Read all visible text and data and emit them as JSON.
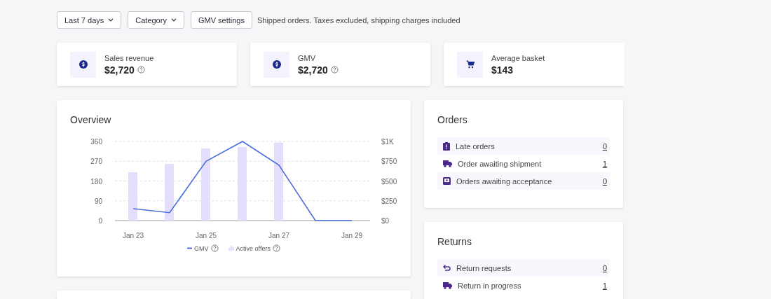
{
  "filters": [
    {
      "label": "Last 7 days",
      "kind": "dropdown"
    },
    {
      "label": "Category",
      "kind": "dropdown"
    },
    {
      "label": "GMV settings",
      "kind": "button"
    }
  ],
  "filter_note": "Shipped orders. Taxes excluded, shipping charges included",
  "kpis": [
    {
      "label": "Sales revenue",
      "value": "$2,720",
      "kind": "money",
      "help": true
    },
    {
      "label": "GMV",
      "value": "$2,720",
      "kind": "money",
      "help": true
    },
    {
      "label": "Average basket",
      "value": "$143",
      "kind": "cart",
      "help": false
    }
  ],
  "overview": {
    "title": "Overview",
    "chart_data": {
      "type": "bar",
      "grid": true,
      "legend": "bottom",
      "categories": [
        "Jan 23",
        null,
        "Jan 25",
        null,
        "Jan 27",
        null,
        "Jan 29"
      ],
      "ylim": [
        0,
        360
      ],
      "yticks": [
        0,
        90,
        180,
        270,
        360
      ],
      "y2lim": [
        0,
        1000
      ],
      "y2ticks": [
        {
          "value": 0,
          "label": "$0"
        },
        {
          "value": 250,
          "label": "$250"
        },
        {
          "value": 500,
          "label": "$500"
        },
        {
          "value": 750,
          "label": "$750"
        },
        {
          "value": 1000,
          "label": "$1K"
        }
      ],
      "series": [
        {
          "name": "GMV",
          "color": "#4a6fdc",
          "type": "line",
          "axis": "y2",
          "values": [
            150,
            100,
            750,
            1000,
            700,
            0,
            0
          ]
        },
        {
          "name": "Active offers",
          "color": "#e3defc",
          "type": "bar",
          "values": [
            220,
            258,
            328,
            335,
            355,
            0,
            0
          ]
        }
      ]
    }
  },
  "orders": {
    "title": "Orders",
    "items": [
      {
        "label": "Late orders",
        "count": "0"
      },
      {
        "label": "Order awaiting shipment",
        "count": "1"
      },
      {
        "label": "Orders awaiting acceptance",
        "count": "0"
      }
    ]
  },
  "returns": {
    "title": "Returns",
    "items": [
      {
        "label": "Return requests",
        "count": "0"
      },
      {
        "label": "Return in progress",
        "count": "1"
      }
    ]
  }
}
